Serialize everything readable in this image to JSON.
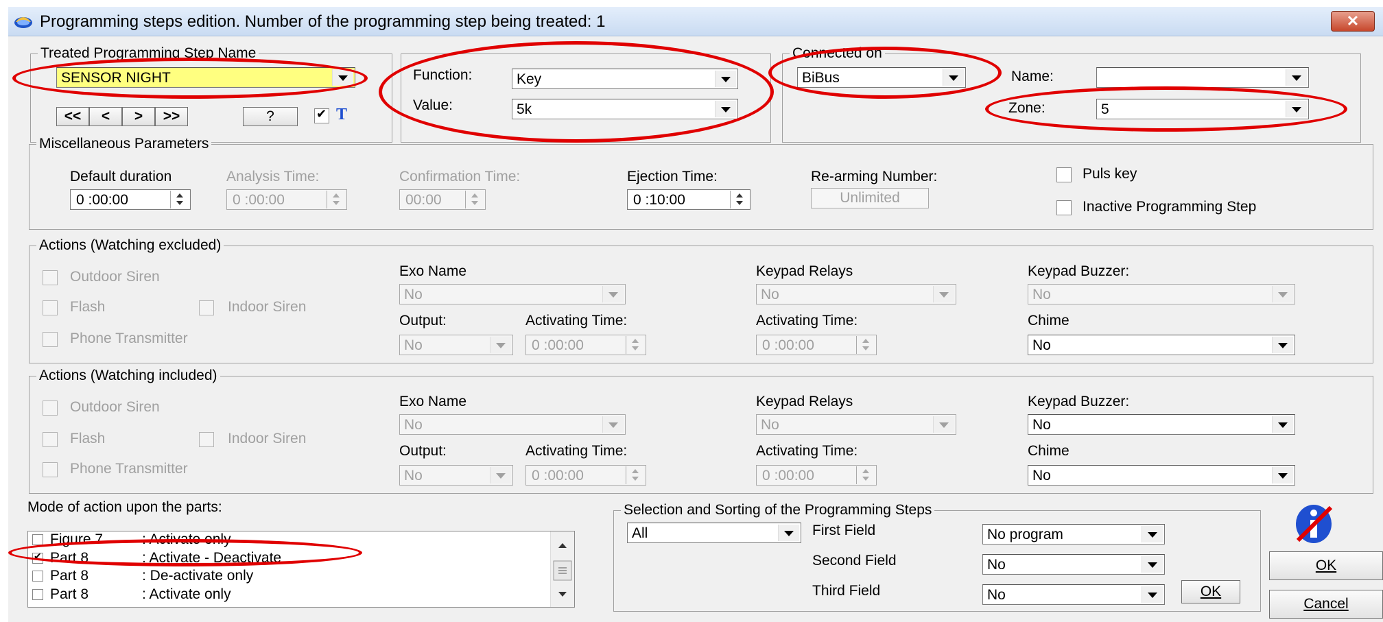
{
  "window": {
    "title": "Programming steps edition.  Number of the programming step being treated: 1",
    "close_label": "✕"
  },
  "treated": {
    "legend": "Treated Programming Step Name",
    "name_value": "SENSOR NIGHT",
    "nav": [
      "<<",
      "<",
      ">",
      ">>",
      "?"
    ],
    "t_label": "T"
  },
  "function_group": {
    "function_label": "Function:",
    "function_value": "Key",
    "value_label": "Value:",
    "value_value": "5k"
  },
  "connected": {
    "legend": "Connected on",
    "bus_value": "BiBus",
    "name_label": "Name:",
    "name_value": "",
    "zone_label": "Zone:",
    "zone_value": "5"
  },
  "misc": {
    "legend": "Miscellaneous Parameters",
    "default_duration_label": "Default duration",
    "default_duration_value": "0 :00:00",
    "analysis_time_label": "Analysis Time:",
    "analysis_time_value": "0 :00:00",
    "confirmation_time_label": "Confirmation Time:",
    "confirmation_time_value": "00:00",
    "ejection_time_label": "Ejection Time:",
    "ejection_time_value": "0 :10:00",
    "rearming_label": "Re-arming Number:",
    "rearming_value": "Unlimited",
    "puls_key_label": "Puls key",
    "inactive_label": "Inactive Programming Step"
  },
  "excluded": {
    "legend": "Actions (Watching excluded)",
    "outdoor_siren": "Outdoor Siren",
    "flash": "Flash",
    "indoor_siren": "Indoor Siren",
    "phone_transmitter": "Phone Transmitter",
    "exo_name_label": "Exo Name",
    "exo_name_value": "No",
    "output_label": "Output:",
    "output_value": "No",
    "activating_time_label": "Activating Time:",
    "activating_time_value": "0 :00:00",
    "keypad_relays_label": "Keypad Relays",
    "keypad_relays_value": "No",
    "relay_activating_time_label": "Activating Time:",
    "relay_activating_time_value": "0 :00:00",
    "keypad_buzzer_label": "Keypad Buzzer:",
    "keypad_buzzer_value": "No",
    "chime_label": "Chime",
    "chime_value": "No"
  },
  "included": {
    "legend": "Actions (Watching included)",
    "outdoor_siren": "Outdoor Siren",
    "flash": "Flash",
    "indoor_siren": "Indoor Siren",
    "phone_transmitter": "Phone Transmitter",
    "exo_name_label": "Exo Name",
    "exo_name_value": "No",
    "output_label": "Output:",
    "output_value": "No",
    "activating_time_label": "Activating Time:",
    "activating_time_value": "0 :00:00",
    "keypad_relays_label": "Keypad Relays",
    "keypad_relays_value": "No",
    "relay_activating_time_label": "Activating Time:",
    "relay_activating_time_value": "0 :00:00",
    "keypad_buzzer_label": "Keypad Buzzer:",
    "keypad_buzzer_value": "No",
    "chime_label": "Chime",
    "chime_value": "No"
  },
  "mode": {
    "label": "Mode of action upon the parts:",
    "items": [
      {
        "part": "Figure 7",
        "action": ": Activate only",
        "checked": false
      },
      {
        "part": "Part 8",
        "action": ": Activate - Deactivate",
        "checked": true
      },
      {
        "part": "Part 8",
        "action": ": De-activate only",
        "checked": false
      },
      {
        "part": "Part 8",
        "action": ": Activate only",
        "checked": false
      }
    ]
  },
  "selection": {
    "legend": "Selection and Sorting of the Programming Steps",
    "filter_value": "All",
    "first_field_label": "First Field",
    "first_field_value": "No program",
    "second_field_label": "Second Field",
    "second_field_value": "No",
    "third_field_label": "Third Field",
    "third_field_value": "No",
    "ok_label": "OK"
  },
  "footer": {
    "ok_label": "OK",
    "cancel_label": "Cancel"
  },
  "colors": {
    "highlight_field": "#ffff80",
    "annotation_red": "#e00000",
    "info_blue": "#1f4fd0"
  }
}
